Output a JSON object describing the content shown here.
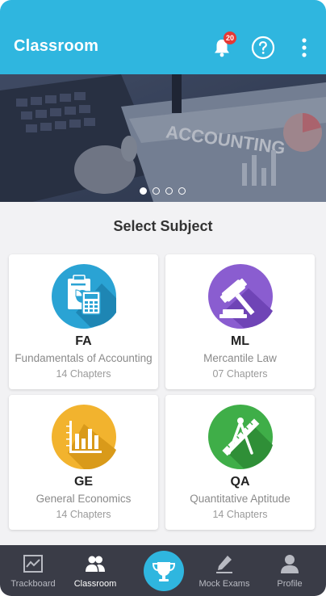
{
  "app_bar": {
    "title": "Classroom",
    "notification_count": "20",
    "icons": [
      "bell-icon",
      "help-icon",
      "more-vert-icon"
    ],
    "color": "#2fb6df"
  },
  "banner": {
    "text": "ACCOUNTING",
    "slides": 4,
    "active_slide": 1
  },
  "section": {
    "title": "Select Subject"
  },
  "subjects": [
    {
      "code": "FA",
      "name": "Fundamentals of Accounting",
      "chapters": "14 Chapters",
      "icon": "accounting-calculator-icon",
      "color": "#2aa3d4"
    },
    {
      "code": "ML",
      "name": "Mercantile Law",
      "chapters": "07 Chapters",
      "icon": "gavel-icon",
      "color": "#8a5dd0"
    },
    {
      "code": "GE",
      "name": "General Economics",
      "chapters": "14 Chapters",
      "icon": "bar-chart-icon",
      "color": "#f2b32e"
    },
    {
      "code": "QA",
      "name": "Quantitative Aptitude",
      "chapters": "14 Chapters",
      "icon": "compass-ruler-icon",
      "color": "#3fae48"
    }
  ],
  "bottom_nav": {
    "items": [
      {
        "label": "Trackboard",
        "icon": "trackboard-icon"
      },
      {
        "label": "Classroom",
        "icon": "classroom-icon",
        "active": true
      },
      {
        "label": "",
        "icon": "trophy-icon"
      },
      {
        "label": "Mock Exams",
        "icon": "pen-icon"
      },
      {
        "label": "Profile",
        "icon": "profile-icon"
      }
    ]
  }
}
